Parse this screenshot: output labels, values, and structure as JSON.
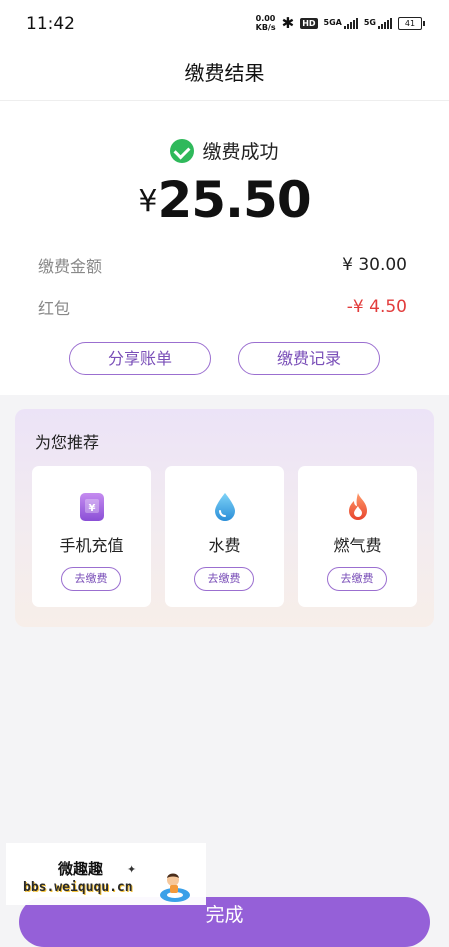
{
  "status_bar": {
    "time": "11:42",
    "net_speed_value": "0.00",
    "net_speed_unit": "KB/s",
    "hd_label": "HD",
    "sim1_label": "5GA",
    "sim2_label": "5G",
    "battery": "41"
  },
  "header": {
    "title": "缴费结果"
  },
  "result": {
    "status_text": "缴费成功",
    "currency": "¥",
    "amount": "25.50",
    "details": [
      {
        "label": "缴费金额",
        "value": "¥ 30.00"
      },
      {
        "label": "红包",
        "value": "-¥ 4.50"
      }
    ],
    "share_label": "分享账单",
    "records_label": "缴费记录"
  },
  "recommend": {
    "title": "为您推荐",
    "items": [
      {
        "name": "手机充值",
        "action": "去缴费",
        "icon": "phone-recharge-icon"
      },
      {
        "name": "水费",
        "action": "去缴费",
        "icon": "water-drop-icon"
      },
      {
        "name": "燃气费",
        "action": "去缴费",
        "icon": "gas-flame-icon"
      }
    ]
  },
  "footer": {
    "done_label": "完成"
  },
  "watermark": {
    "title": "微趣趣",
    "url": "bbs.weiququ.cn"
  },
  "colors": {
    "accent": "#9560d8",
    "success": "#2fb95b",
    "negative": "#e23c3c"
  }
}
